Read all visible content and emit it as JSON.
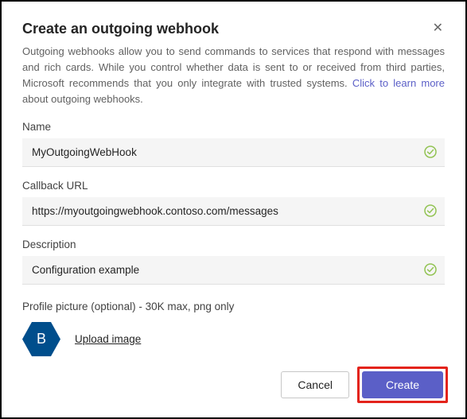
{
  "dialog": {
    "title": "Create an outgoing webhook",
    "close_label": "✕",
    "intro_text": "Outgoing webhooks allow you to send commands to services that respond with messages and rich cards. While you control whether data is sent to or received from third parties, Microsoft recommends that you only integrate with trusted systems. ",
    "intro_link": "Click to learn more",
    "intro_tail": " about outgoing webhooks."
  },
  "fields": {
    "name": {
      "label": "Name",
      "value": "MyOutgoingWebHook"
    },
    "callback": {
      "label": "Callback URL",
      "value": "https://myoutgoingwebhook.contoso.com/messages"
    },
    "description": {
      "label": "Description",
      "value": "Configuration example"
    }
  },
  "profile": {
    "label": "Profile picture (optional) - 30K max, png only",
    "avatar_initial": "B",
    "upload_label": "Upload image"
  },
  "footer": {
    "cancel": "Cancel",
    "create": "Create"
  },
  "colors": {
    "accent": "#5b5fc7",
    "valid": "#8bc34a",
    "avatar_bg": "#004e8c",
    "highlight_border": "#e3231b"
  }
}
